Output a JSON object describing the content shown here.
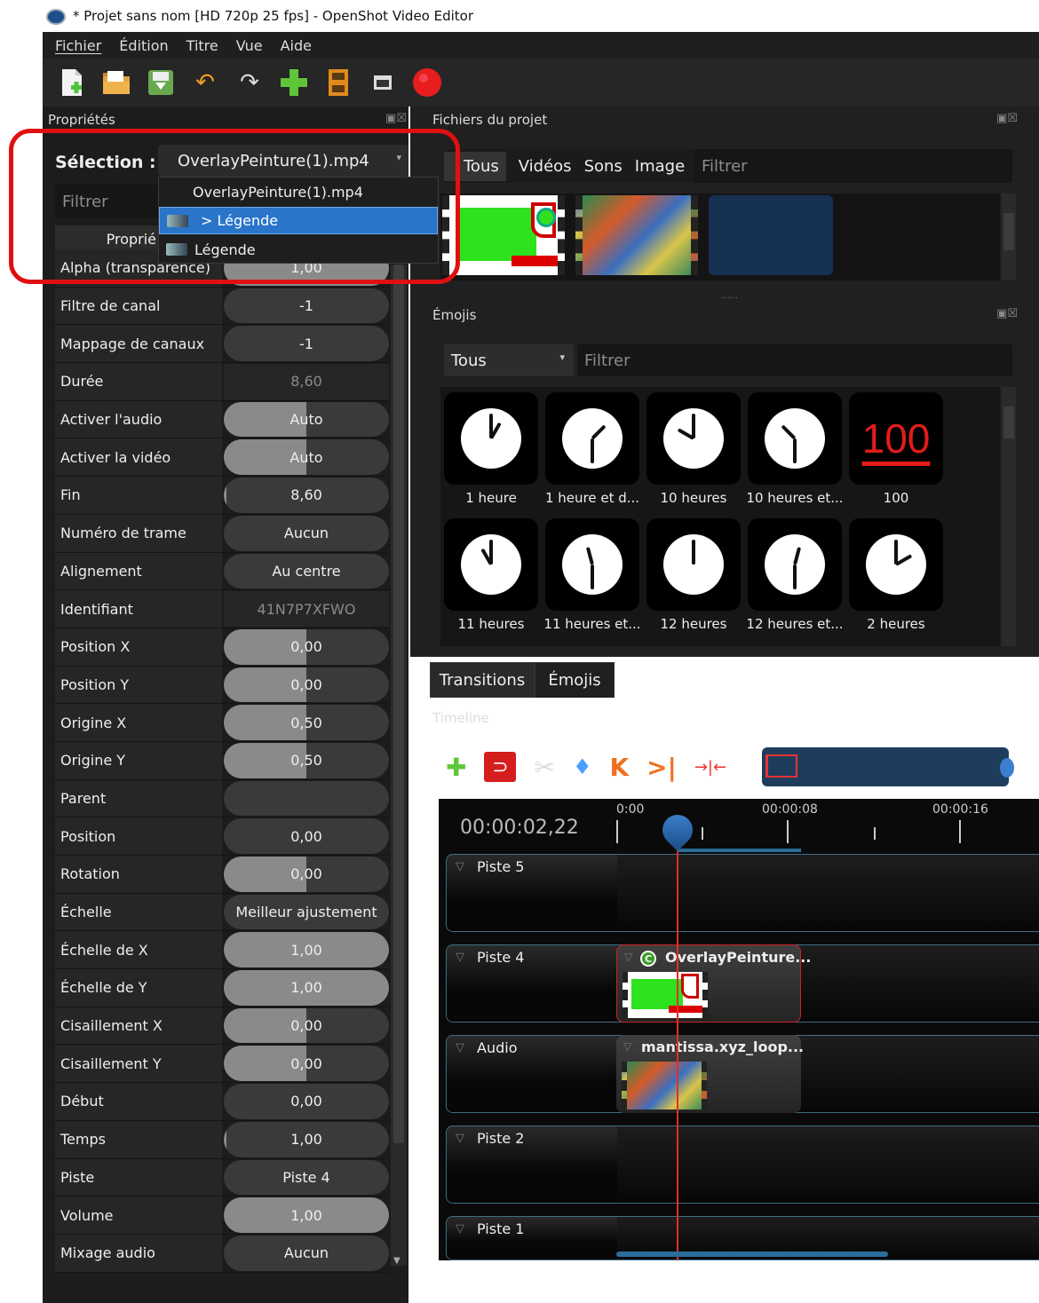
{
  "window": {
    "title": "* Projet sans nom [HD 720p 25 fps] - OpenShot Video Editor"
  },
  "menu": [
    "Fichier",
    "Édition",
    "Titre",
    "Vue",
    "Aide"
  ],
  "toolbar": [
    "new-project-icon",
    "open-project-icon",
    "save-project-icon",
    "undo-icon",
    "redo-icon",
    "import-files-icon",
    "profile-icon",
    "fullscreen-icon",
    "export-video-icon"
  ],
  "properties": {
    "title": "Propriétés",
    "selection_label": "Sélection :",
    "selection_value": "OverlayPeinture(1).mp4",
    "filter_placeholder": "Filtrer",
    "column_header": "Proprié",
    "dropdown": [
      {
        "label": "OverlayPeinture(1).mp4",
        "icon": false,
        "selected": false
      },
      {
        "label": "> Légende",
        "icon": true,
        "selected": true
      },
      {
        "label": "Légende",
        "icon": true,
        "selected": false
      }
    ],
    "rows": [
      {
        "name": "Alpha (transparence)",
        "value": "1,00",
        "fill": 1.0,
        "style": "slider"
      },
      {
        "name": "Filtre de canal",
        "value": "-1",
        "fill": 0,
        "style": "pill"
      },
      {
        "name": "Mappage de canaux",
        "value": "-1",
        "fill": 0,
        "style": "pill"
      },
      {
        "name": "Durée",
        "value": "8,60",
        "fill": 0,
        "style": "flat"
      },
      {
        "name": "Activer l'audio",
        "value": "Auto",
        "fill": 0.5,
        "style": "slider"
      },
      {
        "name": "Activer la vidéo",
        "value": "Auto",
        "fill": 0.5,
        "style": "slider"
      },
      {
        "name": "Fin",
        "value": "8,60",
        "fill": 0.01,
        "style": "slider"
      },
      {
        "name": "Numéro de trame",
        "value": "Aucun",
        "fill": 0,
        "style": "pill"
      },
      {
        "name": "Alignement",
        "value": "Au centre",
        "fill": 0,
        "style": "pill"
      },
      {
        "name": "Identifiant",
        "value": "41N7P7XFWO",
        "fill": 0,
        "style": "flat"
      },
      {
        "name": "Position X",
        "value": "0,00",
        "fill": 0.5,
        "style": "slider"
      },
      {
        "name": "Position Y",
        "value": "0,00",
        "fill": 0.5,
        "style": "slider"
      },
      {
        "name": "Origine X",
        "value": "0,50",
        "fill": 0.5,
        "style": "slider"
      },
      {
        "name": "Origine Y",
        "value": "0,50",
        "fill": 0.5,
        "style": "slider"
      },
      {
        "name": "Parent",
        "value": "",
        "fill": 0,
        "style": "pill"
      },
      {
        "name": "Position",
        "value": "0,00",
        "fill": 0,
        "style": "pill"
      },
      {
        "name": "Rotation",
        "value": "0,00",
        "fill": 0.5,
        "style": "slider"
      },
      {
        "name": "Échelle",
        "value": "Meilleur ajustement",
        "fill": 0,
        "style": "pill"
      },
      {
        "name": "Échelle de X",
        "value": "1,00",
        "fill": 1.0,
        "style": "slider"
      },
      {
        "name": "Échelle de Y",
        "value": "1,00",
        "fill": 1.0,
        "style": "slider"
      },
      {
        "name": "Cisaillement X",
        "value": "0,00",
        "fill": 0.5,
        "style": "slider"
      },
      {
        "name": "Cisaillement Y",
        "value": "0,00",
        "fill": 0.5,
        "style": "slider"
      },
      {
        "name": "Début",
        "value": "0,00",
        "fill": 0,
        "style": "pill"
      },
      {
        "name": "Temps",
        "value": "1,00",
        "fill": 0.01,
        "style": "slider"
      },
      {
        "name": "Piste",
        "value": "Piste 4",
        "fill": 0,
        "style": "pill"
      },
      {
        "name": "Volume",
        "value": "1,00",
        "fill": 1.0,
        "style": "slider"
      },
      {
        "name": "Mixage audio",
        "value": "Aucun",
        "fill": 0,
        "style": "pill"
      }
    ]
  },
  "project_files": {
    "title": "Fichiers du projet",
    "tabs": [
      "Tous",
      "Vidéos",
      "Sons",
      "Image"
    ],
    "filter_placeholder": "Filtrer"
  },
  "emojis": {
    "title": "Émojis",
    "category": "Tous",
    "filter_placeholder": "Filtrer",
    "items": [
      {
        "label": "1 heure",
        "hour": 1
      },
      {
        "label": "1 heure et d...",
        "hour": 1.5
      },
      {
        "label": "10 heures",
        "hour": 10
      },
      {
        "label": "10 heures et...",
        "hour": 10.5
      },
      {
        "label": "100",
        "hour": -1
      },
      {
        "label": "11 heures",
        "hour": 11
      },
      {
        "label": "11 heures et...",
        "hour": 11.5
      },
      {
        "label": "12 heures",
        "hour": 12
      },
      {
        "label": "12 heures et...",
        "hour": 12.5
      },
      {
        "label": "2 heures",
        "hour": 2
      }
    ],
    "emoji_100_text": "100"
  },
  "bottom_tabs": [
    "Transitions",
    "Émojis"
  ],
  "timeline": {
    "title": "Timeline",
    "current_time": "00:00:02,22",
    "ruler": [
      "0:00",
      "00:00:08",
      "00:00:16"
    ],
    "tracks": [
      "Piste 5",
      "Piste 4",
      "Audio",
      "Piste 2",
      "Piste 1"
    ],
    "clip_video": "OverlayPeinture...",
    "clip_video_badge": "C",
    "clip_audio": "mantissa.xyz_loop..."
  },
  "colors": {
    "accent_blue": "#2a74c9",
    "highlight_red": "#e01010",
    "playhead": "#e22d2d"
  }
}
